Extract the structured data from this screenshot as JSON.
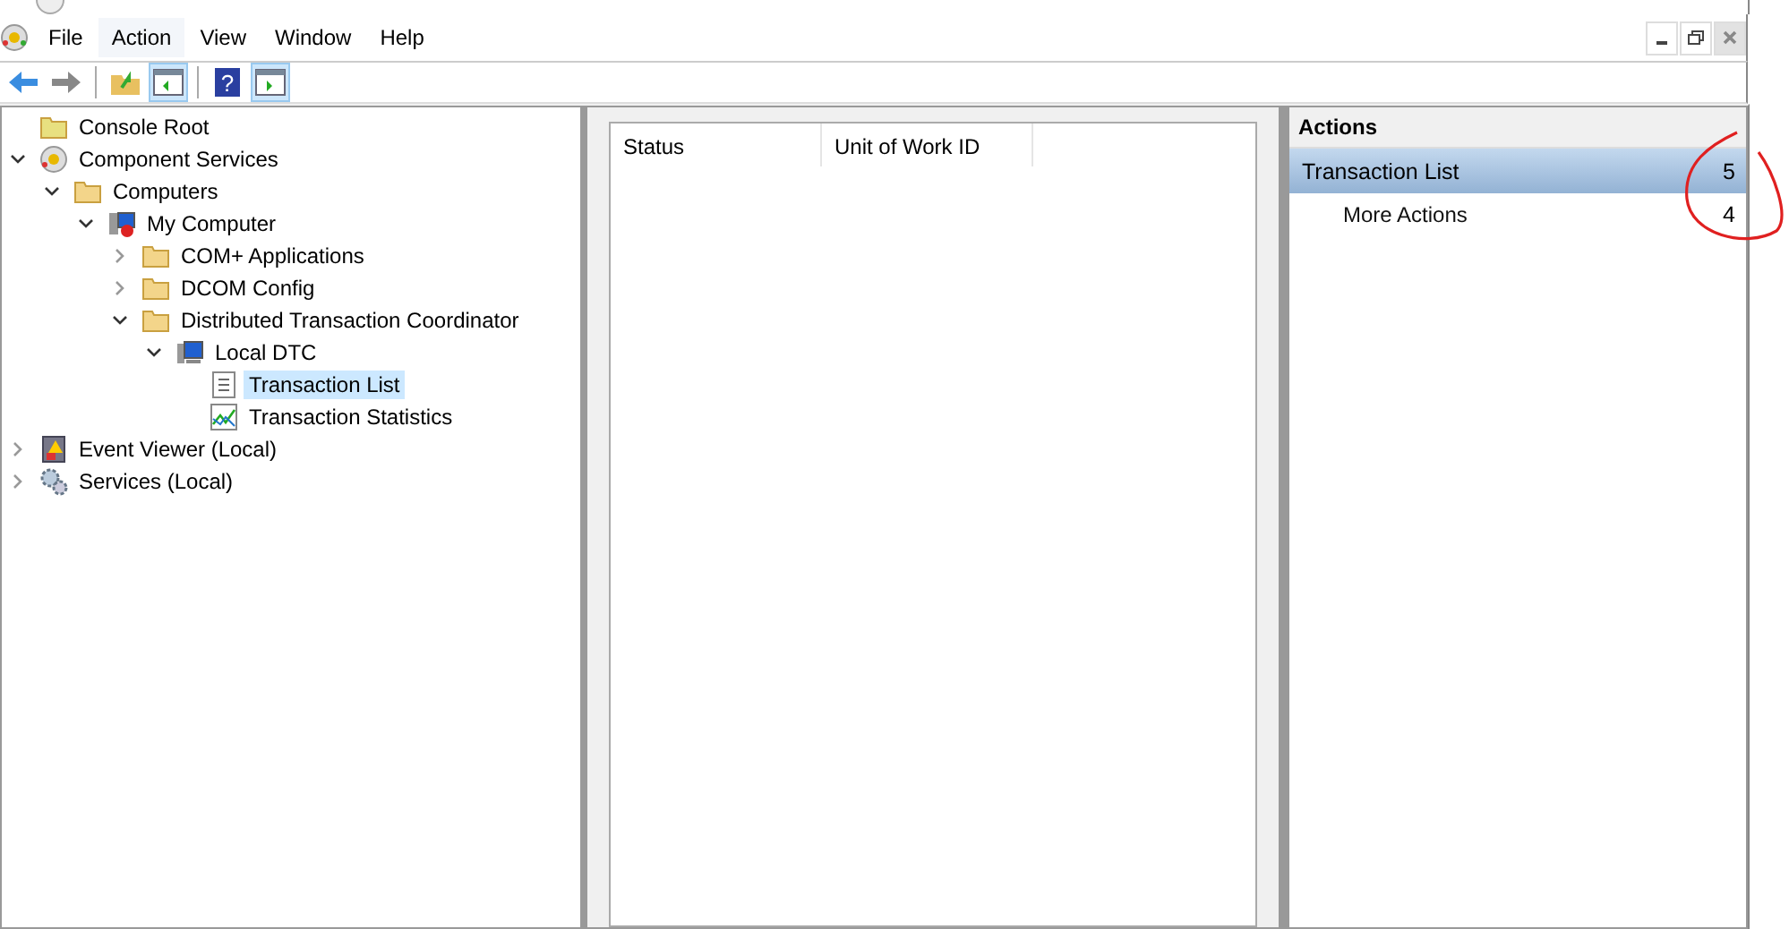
{
  "menu": [
    {
      "label": "File",
      "selected": false
    },
    {
      "label": "Action",
      "selected": true
    },
    {
      "label": "View",
      "selected": false
    },
    {
      "label": "Window",
      "selected": false
    },
    {
      "label": "Help",
      "selected": false
    }
  ],
  "toolbar": [
    {
      "kind": "back",
      "pressed": false
    },
    {
      "kind": "forward",
      "pressed": false
    },
    {
      "kind": "sep"
    },
    {
      "kind": "up",
      "pressed": false
    },
    {
      "kind": "tree",
      "pressed": true
    },
    {
      "kind": "sep"
    },
    {
      "kind": "help",
      "label": "?",
      "pressed": false
    },
    {
      "kind": "pane",
      "pressed": true
    }
  ],
  "tree": [
    {
      "label": "Console Root",
      "kind": "root"
    },
    {
      "label": "Component Services",
      "kind": "component",
      "expanded": true,
      "children": [
        {
          "label": "Computers",
          "kind": "folder",
          "expanded": true,
          "children": [
            {
              "label": "My Computer",
              "kind": "computer",
              "expanded": true,
              "children": [
                {
                  "label": "COM+ Applications",
                  "kind": "folder",
                  "expanded": false
                },
                {
                  "label": "DCOM Config",
                  "kind": "folder",
                  "expanded": false
                },
                {
                  "label": "Distributed Transaction Coordinator",
                  "kind": "folder",
                  "expanded": true,
                  "children": [
                    {
                      "label": "Local DTC",
                      "kind": "monitor",
                      "expanded": true,
                      "children": [
                        {
                          "label": "Transaction List",
                          "kind": "list",
                          "selected": true
                        },
                        {
                          "label": "Transaction Statistics",
                          "kind": "chart",
                          "selected": false
                        }
                      ]
                    }
                  ]
                }
              ]
            }
          ]
        }
      ]
    },
    {
      "label": "Event Viewer (Local)",
      "kind": "log",
      "expanded": false
    },
    {
      "label": "Services (Local)",
      "kind": "services",
      "expanded": false
    }
  ],
  "table": {
    "columns": [
      "Status",
      "Unit of Work ID"
    ]
  },
  "actions": {
    "title": "Actions",
    "sections": [
      {
        "label": "Transaction List",
        "count": "5",
        "selected": true,
        "items": [
          {
            "label": "More Actions",
            "count": "4"
          }
        ]
      }
    ]
  }
}
